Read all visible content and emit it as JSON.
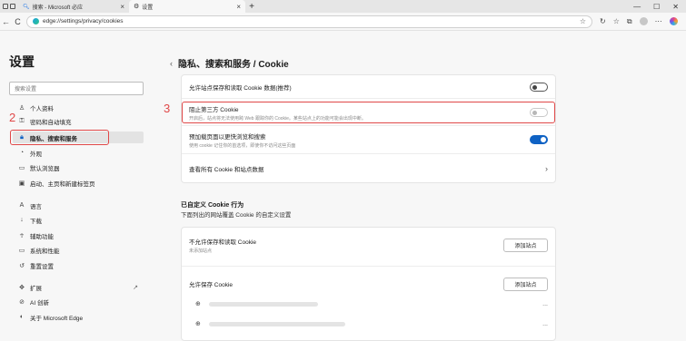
{
  "tabs": [
    {
      "title": "搜索 - Microsoft 必应",
      "close": "×"
    },
    {
      "title": "设置",
      "close": "×"
    }
  ],
  "newtab": "+",
  "window_controls": {
    "minimize": "—",
    "maximize": "☐",
    "close": "✕"
  },
  "nav": {
    "back": "←",
    "refresh": "C",
    "url": "edge://settings/privacy/cookies"
  },
  "sidebar": {
    "title": "设置",
    "search_placeholder": "搜索设置",
    "items": [
      {
        "label": "个人资料",
        "icon": "person-icon"
      },
      {
        "label": "密码和自动填充",
        "icon": "key-icon"
      },
      {
        "label": "隐私、搜索和服务",
        "icon": "lock-icon"
      },
      {
        "label": "外观",
        "icon": "palette-icon"
      },
      {
        "label": "默认浏览器",
        "icon": "browser-icon"
      },
      {
        "label": "启动、主页和新建标签页",
        "icon": "tabs-icon"
      },
      {
        "label": "语言",
        "icon": "language-icon"
      },
      {
        "label": "下载",
        "icon": "download-icon"
      },
      {
        "label": "辅助功能",
        "icon": "accessibility-icon"
      },
      {
        "label": "系统和性能",
        "icon": "laptop-icon"
      },
      {
        "label": "重置设置",
        "icon": "reset-icon"
      },
      {
        "label": "扩展",
        "icon": "puzzle-icon"
      },
      {
        "label": "AI 创新",
        "icon": "ai-icon"
      },
      {
        "label": "关于 Microsoft Edge",
        "icon": "edge-logo-icon"
      }
    ]
  },
  "annotations": {
    "step2": "2",
    "step3": "3"
  },
  "main": {
    "breadcrumb": "隐私、搜索和服务 / Cookie",
    "settings": [
      {
        "label": "允许站点保存和读取 Cookie 数据(推荐)",
        "desc": "",
        "state": "off"
      },
      {
        "label": "阻止第三方 Cookie",
        "desc": "开启后，站点将无法使用跨 Web 跟踪你的 Cookie。某些站点上的功能可能会出现中断。",
        "state": "dim"
      },
      {
        "label": "预加载页面以更快浏览和搜索",
        "desc": "使用 cookie 记住你的首选项，即使你不访问这些页面",
        "state": "on"
      },
      {
        "label": "查看所有 Cookie 和站点数据",
        "desc": "",
        "state": "link"
      }
    ],
    "custom_title": "已自定义 Cookie 行为",
    "custom_sub": "下面列出的网站覆盖 Cookie 的自定义设置",
    "block_section": {
      "label": "不允许保存和读取 Cookie",
      "sub": "未添加站点",
      "button": "添加站点"
    },
    "allow_section": {
      "label": "允许保存 Cookie",
      "button": "添加站点",
      "more": "..."
    }
  }
}
